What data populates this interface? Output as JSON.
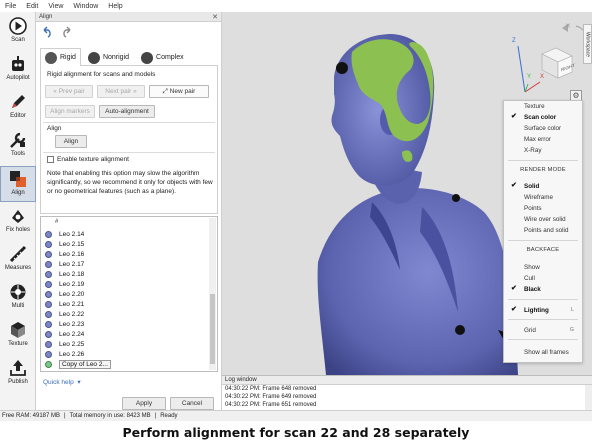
{
  "menubar": [
    "File",
    "Edit",
    "View",
    "Window",
    "Help"
  ],
  "toolbar": [
    {
      "label": "Scan",
      "icon": "scan-icon"
    },
    {
      "label": "Autopilot",
      "icon": "autopilot-icon"
    },
    {
      "label": "Editor",
      "icon": "editor-icon"
    },
    {
      "label": "Tools",
      "icon": "tools-icon"
    },
    {
      "label": "Align",
      "icon": "align-icon",
      "active": true
    },
    {
      "label": "Fix holes",
      "icon": "fix-holes-icon"
    },
    {
      "label": "Measures",
      "icon": "measures-icon"
    },
    {
      "label": "Multi",
      "icon": "multi-icon"
    },
    {
      "label": "Texture",
      "icon": "texture-icon"
    },
    {
      "label": "Publish",
      "icon": "publish-icon"
    }
  ],
  "panel": {
    "title": "Align",
    "tabs": [
      "Rigid",
      "Nonrigid",
      "Complex"
    ],
    "subtitle": "Rigid alignment for scans and models",
    "prev_pair": "Prev pair",
    "next_pair": "Next pair",
    "new_pair": "New pair",
    "align_markers": "Align markers",
    "auto_alignment": "Auto-alignment",
    "align_section": "Align",
    "align_button": "Align",
    "texture_checkbox": "Enable texture alignment",
    "note": "Note that enabling this option may slow the algorithm significantly, so we recommend it only for objects with few or no geometrical features (such as a plane).",
    "list_header": "#",
    "scans": [
      "Leo 2.14",
      "Leo 2.15",
      "Leo 2.16",
      "Leo 2.17",
      "Leo 2.18",
      "Leo 2.19",
      "Leo 2.20",
      "Leo 2.21",
      "Leo 2.22",
      "Leo 2.23",
      "Leo 2.24",
      "Leo 2.25",
      "Leo 2.26",
      "Copy of Leo 2..."
    ],
    "quick_help": "Quick help",
    "apply": "Apply",
    "cancel": "Cancel"
  },
  "viewport": {
    "cube_label": "RIGHT",
    "axis_x": "X",
    "axis_y": "Y",
    "axis_z": "Z",
    "workspace_tab": "Workspace",
    "mesh_colors": {
      "scan_blue": "#6b74c2",
      "scan_green": "#8cc152",
      "background": "#dedede"
    }
  },
  "render_menu": {
    "top_items": [
      {
        "label": "Texture",
        "checked": false
      },
      {
        "label": "Scan color",
        "checked": true
      },
      {
        "label": "Surface color",
        "checked": false
      },
      {
        "label": "Max error",
        "checked": false
      },
      {
        "label": "X-Ray",
        "checked": false
      }
    ],
    "render_mode_header": "RENDER MODE",
    "render_modes": [
      {
        "label": "Solid",
        "checked": true
      },
      {
        "label": "Wireframe",
        "checked": false
      },
      {
        "label": "Points",
        "checked": false
      },
      {
        "label": "Wire over solid",
        "checked": false
      },
      {
        "label": "Points and solid",
        "checked": false
      }
    ],
    "backface_header": "BACKFACE",
    "backface": [
      {
        "label": "Show",
        "checked": false
      },
      {
        "label": "Cull",
        "checked": false
      },
      {
        "label": "Black",
        "checked": true
      }
    ],
    "lighting": {
      "label": "Lighting",
      "key": "L",
      "checked": true
    },
    "grid": {
      "label": "Grid",
      "key": "G",
      "checked": false
    },
    "show_all_frames": "Show all frames"
  },
  "log": {
    "title": "Log window",
    "lines": [
      "04:30:22 PM: Frame 648 removed",
      "04:30:22 PM: Frame 649 removed",
      "04:30:22 PM: Frame 651 removed"
    ]
  },
  "status": {
    "free_ram": "Free RAM: 49187 MB",
    "total_memory": "Total memory in use: 8423 MB",
    "state": "Ready"
  },
  "caption": "Perform alignment for scan 22 and 28 separately"
}
